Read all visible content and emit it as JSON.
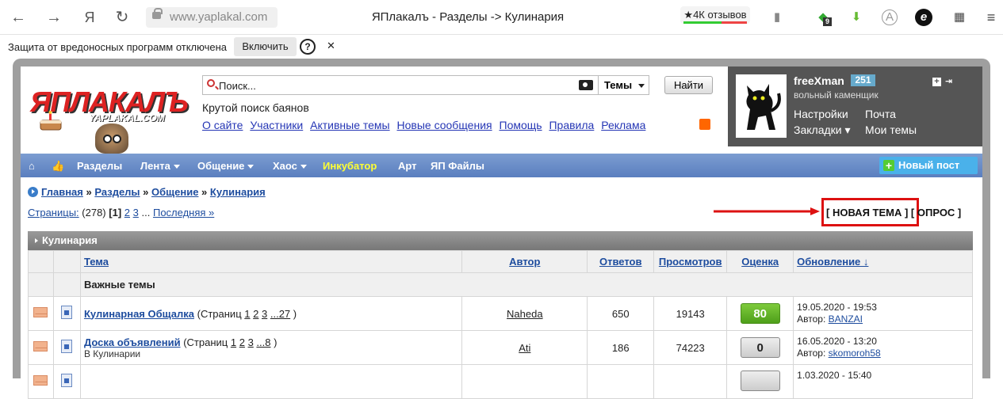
{
  "browser": {
    "url": "www.yaplakal.com",
    "page_title": "ЯПлакалъ - Разделы -> Кулинария",
    "reviews": "4К отзывов",
    "ext_badge": "9",
    "security_notice": "Защита от вредоносных программ отключена",
    "enable_btn": "Включить"
  },
  "header": {
    "logo_main": "ЯПЛАКАЛЪ",
    "logo_sub": "YAPLAKAL.COM",
    "search_placeholder": "Поиск...",
    "search_scope": "Темы",
    "find_btn": "Найти",
    "tagline": "Крутой поиск баянов",
    "links": [
      "О сайте",
      "Участники",
      "Активные темы",
      "Новые сообщения",
      "Помощь",
      "Правила",
      "Реклама"
    ]
  },
  "user": {
    "name": "freeXman",
    "reputation": "251",
    "rank": "вольный каменщик",
    "settings": "Настройки",
    "mail": "Почта",
    "bookmarks": "Закладки",
    "my_topics": "Мои темы"
  },
  "nav": {
    "items": [
      "Разделы",
      "Лента",
      "Общение",
      "Хаос",
      "Инкубатор",
      "Арт",
      "ЯП Файлы"
    ],
    "new_post": "Новый пост"
  },
  "breadcrumb": [
    "Главная",
    "Разделы",
    "Общение",
    "Кулинария"
  ],
  "pagination": {
    "label": "Страницы:",
    "total": "(278)",
    "current": "[1]",
    "pages": [
      "2",
      "3"
    ],
    "ellipsis": "...",
    "last": "Последняя »"
  },
  "actions": {
    "new_topic": "[ НОВАЯ ТЕМА ]",
    "poll": "[ ОПРОС ]"
  },
  "forum": {
    "section_title": "Кулинария",
    "columns": [
      "Тема",
      "Автор",
      "Ответов",
      "Просмотров",
      "Оценка",
      "Обновление ↓"
    ],
    "pinned_label": "Важные темы",
    "topics": [
      {
        "title": "Кулинарная Общалка",
        "pages_prefix": "(Страниц",
        "pages": [
          "1",
          "2",
          "3",
          "...27"
        ],
        "pages_suffix": ")",
        "subtitle": "",
        "author": "Naheda",
        "replies": "650",
        "views": "19143",
        "rating": "80",
        "updated": "19.05.2020 - 19:53",
        "last_label": "Автор:",
        "last_author": "BANZAI"
      },
      {
        "title": "Доска объявлений",
        "pages_prefix": "(Страниц",
        "pages": [
          "1",
          "2",
          "3",
          "...8"
        ],
        "pages_suffix": ")",
        "subtitle": "В Кулинарии",
        "author": "Ati",
        "replies": "186",
        "views": "74223",
        "rating": "0",
        "updated": "16.05.2020 - 13:20",
        "last_label": "Автор:",
        "last_author": "skomoroh58"
      },
      {
        "updated": "1.03.2020 - 15:40"
      }
    ]
  }
}
